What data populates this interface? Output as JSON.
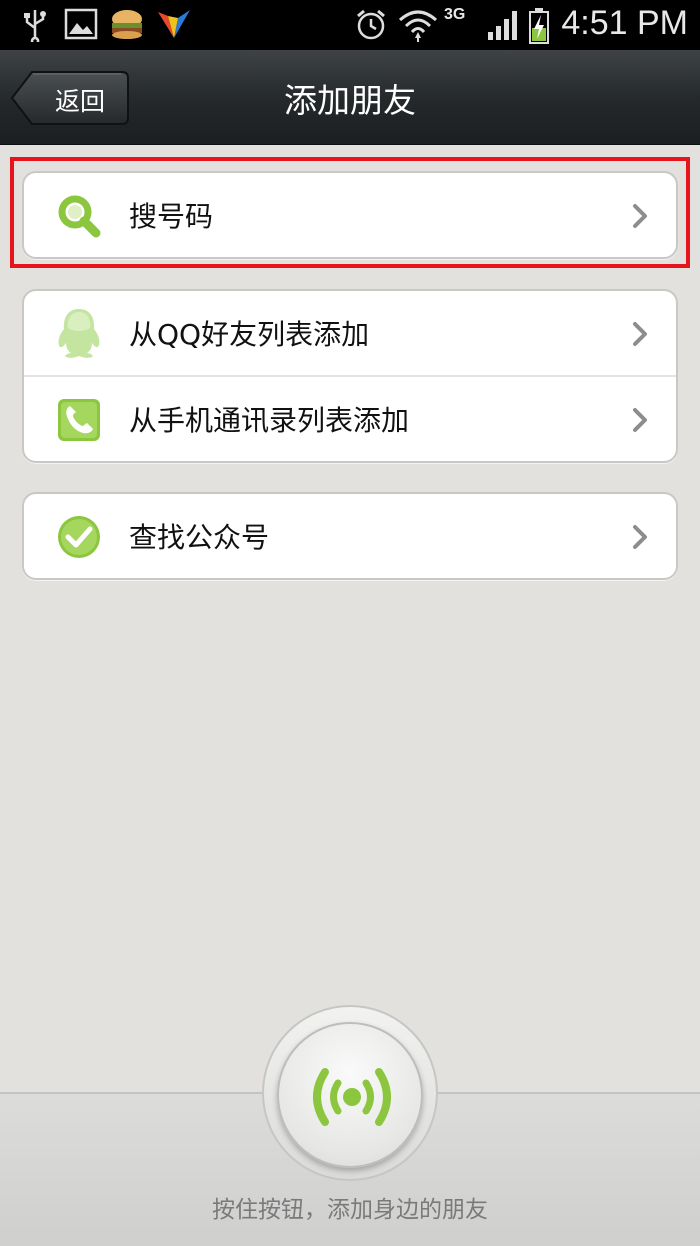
{
  "status_bar": {
    "time": "4:51 PM",
    "network": "3G",
    "icons": [
      "usb-icon",
      "image-icon",
      "burger-app-icon",
      "bird-app-icon",
      "alarm-icon",
      "wifi-icon",
      "signal-icon",
      "battery-charging-icon"
    ]
  },
  "header": {
    "back_label": "返回",
    "title": "添加朋友"
  },
  "groups": [
    {
      "items": [
        {
          "label": "搜号码",
          "icon": "search-icon"
        }
      ]
    },
    {
      "items": [
        {
          "label": "从QQ好友列表添加",
          "icon": "qq-penguin-icon"
        },
        {
          "label": "从手机通讯录列表添加",
          "icon": "phone-contacts-icon"
        }
      ]
    },
    {
      "items": [
        {
          "label": "查找公众号",
          "icon": "check-badge-icon"
        }
      ]
    }
  ],
  "radar": {
    "hint": "按住按钮，添加身边的朋友",
    "icon": "radar-broadcast-icon"
  },
  "colors": {
    "accent_green": "#8cc63f",
    "highlight_red": "#e8141d",
    "background": "#e2e1de"
  }
}
